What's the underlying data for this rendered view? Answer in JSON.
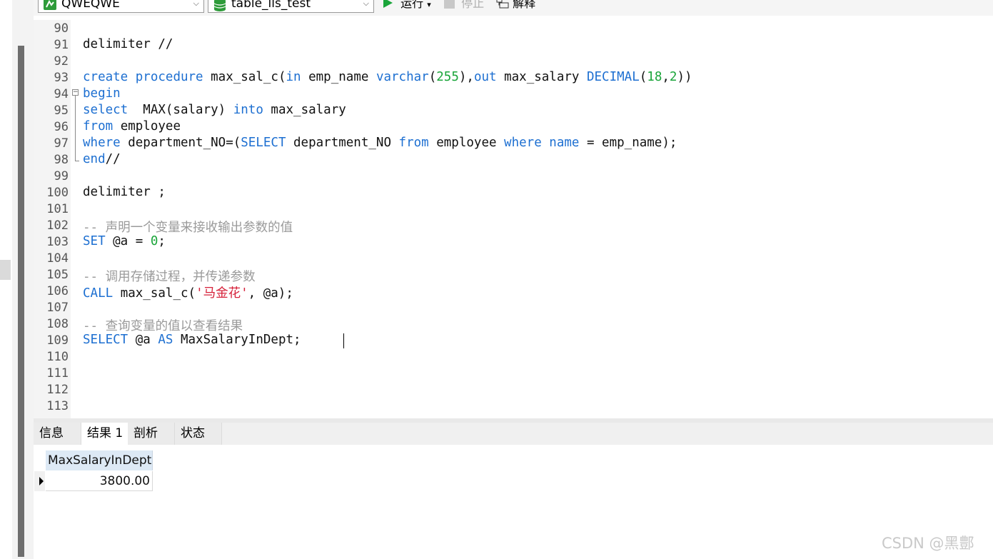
{
  "toolbar": {
    "connection": "QWEQWE",
    "database": "table_lls_test",
    "run_label": "运行",
    "run_dropdown": "▾",
    "stop_label": "停止",
    "explain_label": "解释",
    "colors": {
      "run": "#1aa53a",
      "db": "#2e9b3a"
    }
  },
  "editor": {
    "lines": [
      {
        "n": "90",
        "tokens": []
      },
      {
        "n": "91",
        "tokens": [
          {
            "t": "delimiter //",
            "c": ""
          }
        ]
      },
      {
        "n": "92",
        "tokens": []
      },
      {
        "n": "93",
        "tokens": [
          {
            "t": "create",
            "c": "kw"
          },
          {
            "t": " ",
            "c": ""
          },
          {
            "t": "procedure",
            "c": "kw"
          },
          {
            "t": " max_sal_c(",
            "c": ""
          },
          {
            "t": "in",
            "c": "kw"
          },
          {
            "t": " emp_name ",
            "c": ""
          },
          {
            "t": "varchar",
            "c": "kw"
          },
          {
            "t": "(",
            "c": ""
          },
          {
            "t": "255",
            "c": "num"
          },
          {
            "t": "),",
            "c": ""
          },
          {
            "t": "out",
            "c": "kw"
          },
          {
            "t": " max_salary ",
            "c": ""
          },
          {
            "t": "DECIMAL",
            "c": "kw"
          },
          {
            "t": "(",
            "c": ""
          },
          {
            "t": "18",
            "c": "num"
          },
          {
            "t": ",",
            "c": ""
          },
          {
            "t": "2",
            "c": "num"
          },
          {
            "t": "))",
            "c": ""
          }
        ]
      },
      {
        "n": "94",
        "tokens": [
          {
            "t": "begin",
            "c": "kw"
          }
        ]
      },
      {
        "n": "95",
        "tokens": [
          {
            "t": "select",
            "c": "kw"
          },
          {
            "t": "  MAX(salary) ",
            "c": ""
          },
          {
            "t": "into",
            "c": "kw"
          },
          {
            "t": " max_salary",
            "c": ""
          }
        ]
      },
      {
        "n": "96",
        "tokens": [
          {
            "t": "from",
            "c": "kw"
          },
          {
            "t": " employee",
            "c": ""
          }
        ]
      },
      {
        "n": "97",
        "tokens": [
          {
            "t": "where",
            "c": "kw"
          },
          {
            "t": " department_NO=(",
            "c": ""
          },
          {
            "t": "SELECT",
            "c": "kw"
          },
          {
            "t": " department_NO ",
            "c": ""
          },
          {
            "t": "from",
            "c": "kw"
          },
          {
            "t": " employee ",
            "c": ""
          },
          {
            "t": "where",
            "c": "kw"
          },
          {
            "t": " ",
            "c": ""
          },
          {
            "t": "name",
            "c": "kw"
          },
          {
            "t": " = emp_name);",
            "c": ""
          }
        ]
      },
      {
        "n": "98",
        "tokens": [
          {
            "t": "end",
            "c": "kw"
          },
          {
            "t": "//",
            "c": ""
          }
        ]
      },
      {
        "n": "99",
        "tokens": []
      },
      {
        "n": "100",
        "tokens": [
          {
            "t": "delimiter ;",
            "c": ""
          }
        ]
      },
      {
        "n": "101",
        "tokens": []
      },
      {
        "n": "102",
        "tokens": [
          {
            "t": "-- 声明一个变量来接收输出参数的值",
            "c": "cm"
          }
        ]
      },
      {
        "n": "103",
        "tokens": [
          {
            "t": "SET",
            "c": "kw"
          },
          {
            "t": " @a = ",
            "c": ""
          },
          {
            "t": "0",
            "c": "num"
          },
          {
            "t": ";",
            "c": ""
          }
        ]
      },
      {
        "n": "104",
        "tokens": []
      },
      {
        "n": "105",
        "tokens": [
          {
            "t": "-- 调用存储过程，并传递参数",
            "c": "cm"
          }
        ]
      },
      {
        "n": "106",
        "tokens": [
          {
            "t": "CALL",
            "c": "kw"
          },
          {
            "t": " max_sal_c(",
            "c": ""
          },
          {
            "t": "'马金花'",
            "c": "str"
          },
          {
            "t": ", @a);",
            "c": ""
          }
        ]
      },
      {
        "n": "107",
        "tokens": []
      },
      {
        "n": "108",
        "tokens": [
          {
            "t": "-- 查询变量的值以查看结果",
            "c": "cm"
          }
        ]
      },
      {
        "n": "109",
        "tokens": [
          {
            "t": "SELECT",
            "c": "kw"
          },
          {
            "t": " @a ",
            "c": ""
          },
          {
            "t": "AS",
            "c": "kw"
          },
          {
            "t": " MaxSalaryInDept;",
            "c": ""
          }
        ]
      },
      {
        "n": "110",
        "tokens": []
      },
      {
        "n": "111",
        "tokens": []
      },
      {
        "n": "112",
        "tokens": []
      },
      {
        "n": "113",
        "tokens": []
      }
    ]
  },
  "result_tabs": [
    {
      "label": "信息",
      "active": false
    },
    {
      "label": "结果 1",
      "active": true
    },
    {
      "label": "剖析",
      "active": false
    },
    {
      "label": "状态",
      "active": false
    }
  ],
  "result_grid": {
    "column": "MaxSalaryInDept",
    "value": "3800.00"
  },
  "watermark": "CSDN @黑鄷"
}
